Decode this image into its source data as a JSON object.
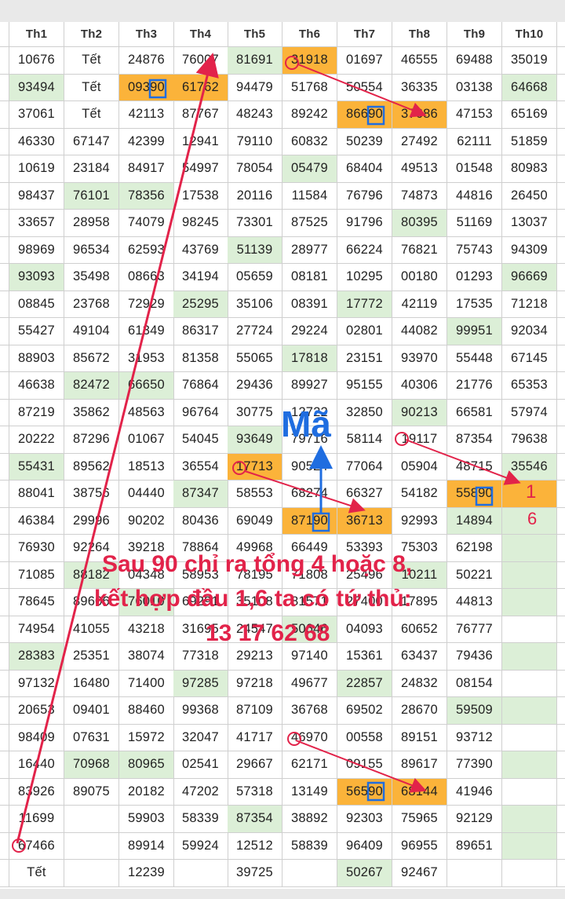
{
  "headers": [
    "Th1",
    "Th2",
    "Th3",
    "Th4",
    "Th5",
    "Th6",
    "Th7",
    "Th8",
    "Th9",
    "Th10"
  ],
  "rows": [
    [
      "10676",
      "Tết",
      "24876",
      "76007",
      "81691",
      "31918",
      "01697",
      "46555",
      "69488",
      "35019"
    ],
    [
      "93494",
      "Tết",
      "09390",
      "61762",
      "94479",
      "51768",
      "50554",
      "36335",
      "03138",
      "64668"
    ],
    [
      "37061",
      "Tết",
      "42113",
      "87767",
      "48243",
      "89242",
      "86690",
      "37686",
      "47153",
      "65169"
    ],
    [
      "46330",
      "67147",
      "42399",
      "12941",
      "79110",
      "60832",
      "50239",
      "27492",
      "62111",
      "51859"
    ],
    [
      "10619",
      "23184",
      "84917",
      "54997",
      "78054",
      "05479",
      "68404",
      "49513",
      "01548",
      "80983"
    ],
    [
      "98437",
      "76101",
      "78356",
      "17538",
      "20116",
      "11584",
      "76796",
      "74873",
      "44816",
      "26450"
    ],
    [
      "33657",
      "28958",
      "74079",
      "98245",
      "73301",
      "87525",
      "91796",
      "80395",
      "51169",
      "13037"
    ],
    [
      "98969",
      "96534",
      "62593",
      "43769",
      "51139",
      "28977",
      "66224",
      "76821",
      "75743",
      "94309"
    ],
    [
      "93093",
      "35498",
      "08663",
      "34194",
      "05659",
      "08181",
      "10295",
      "00180",
      "01293",
      "96669"
    ],
    [
      "08845",
      "23768",
      "72929",
      "25295",
      "35106",
      "08391",
      "17772",
      "42119",
      "17535",
      "71218"
    ],
    [
      "55427",
      "49104",
      "61349",
      "86317",
      "27724",
      "29224",
      "02801",
      "44082",
      "99951",
      "92034"
    ],
    [
      "88903",
      "85672",
      "31953",
      "81358",
      "55065",
      "17818",
      "23151",
      "93970",
      "55448",
      "67145"
    ],
    [
      "46638",
      "82472",
      "66650",
      "76864",
      "29436",
      "89927",
      "95155",
      "40306",
      "21776",
      "65353"
    ],
    [
      "87219",
      "35862",
      "48563",
      "96764",
      "30775",
      "12722",
      "32850",
      "90213",
      "66581",
      "57974"
    ],
    [
      "20222",
      "87296",
      "01067",
      "54045",
      "93649",
      "79716",
      "58114",
      "19117",
      "87354",
      "79638"
    ],
    [
      "55431",
      "89562",
      "18513",
      "36554",
      "17713",
      "90524",
      "77064",
      "05904",
      "48715",
      "35546"
    ],
    [
      "88041",
      "38756",
      "04440",
      "87347",
      "58553",
      "68274",
      "66327",
      "54182",
      "55890",
      ""
    ],
    [
      "46384",
      "29996",
      "90202",
      "80436",
      "69049",
      "87190",
      "36713",
      "92993",
      "14894",
      ""
    ],
    [
      "76930",
      "92264",
      "39218",
      "78864",
      "49968",
      "66449",
      "53393",
      "75303",
      "62198",
      ""
    ],
    [
      "71085",
      "88182",
      "04348",
      "58953",
      "78195",
      "71808",
      "25496",
      "10211",
      "50221",
      ""
    ],
    [
      "78645",
      "89606",
      "76010",
      "69291",
      "35108",
      "81571",
      "27400",
      "17895",
      "44813",
      ""
    ],
    [
      "74954",
      "41055",
      "43218",
      "31695",
      "24547",
      "50646",
      "04093",
      "60652",
      "76777",
      ""
    ],
    [
      "28383",
      "25351",
      "38074",
      "77318",
      "29213",
      "97140",
      "15361",
      "63437",
      "79436",
      ""
    ],
    [
      "97132",
      "16480",
      "71400",
      "97285",
      "97218",
      "49677",
      "22857",
      "24832",
      "08154",
      ""
    ],
    [
      "20653",
      "09401",
      "88460",
      "99368",
      "87109",
      "36768",
      "69502",
      "28670",
      "59509",
      ""
    ],
    [
      "98409",
      "07631",
      "15972",
      "32047",
      "41717",
      "46970",
      "00558",
      "89151",
      "93712",
      ""
    ],
    [
      "16440",
      "70968",
      "80965",
      "02541",
      "29667",
      "62171",
      "09155",
      "89617",
      "77390",
      ""
    ],
    [
      "83926",
      "89075",
      "20182",
      "47202",
      "57318",
      "13149",
      "56590",
      "68144",
      "41946",
      ""
    ],
    [
      "11699",
      "",
      "59903",
      "58339",
      "87354",
      "38892",
      "92303",
      "75965",
      "92129",
      ""
    ],
    [
      "67466",
      "",
      "89914",
      "59924",
      "12512",
      "58839",
      "96409",
      "96955",
      "89651",
      ""
    ],
    [
      "Tết",
      "",
      "12239",
      "",
      "39725",
      "",
      "50267",
      "92467",
      "",
      ""
    ]
  ],
  "green_cells": [
    [
      1,
      0
    ],
    [
      0,
      4
    ],
    [
      1,
      9
    ],
    [
      5,
      1
    ],
    [
      5,
      2
    ],
    [
      4,
      5
    ],
    [
      6,
      7
    ],
    [
      7,
      4
    ],
    [
      8,
      0
    ],
    [
      8,
      9
    ],
    [
      9,
      3
    ],
    [
      9,
      6
    ],
    [
      10,
      8
    ],
    [
      11,
      5
    ],
    [
      12,
      1
    ],
    [
      12,
      2
    ],
    [
      13,
      7
    ],
    [
      14,
      4
    ],
    [
      15,
      0
    ],
    [
      15,
      9
    ],
    [
      16,
      3
    ],
    [
      17,
      8
    ],
    [
      19,
      1
    ],
    [
      19,
      7
    ],
    [
      20,
      2
    ],
    [
      21,
      5
    ],
    [
      22,
      0
    ],
    [
      23,
      3
    ],
    [
      23,
      6
    ],
    [
      24,
      8
    ],
    [
      26,
      1
    ],
    [
      26,
      2
    ],
    [
      28,
      4
    ],
    [
      30,
      6
    ],
    [
      16,
      9
    ],
    [
      17,
      9
    ],
    [
      18,
      9
    ],
    [
      19,
      9
    ],
    [
      20,
      9
    ],
    [
      22,
      9
    ],
    [
      24,
      9
    ],
    [
      26,
      9
    ],
    [
      28,
      9
    ],
    [
      29,
      9
    ]
  ],
  "orange_cells": [
    [
      0,
      5
    ],
    [
      1,
      2
    ],
    [
      1,
      3
    ],
    [
      2,
      6
    ],
    [
      2,
      7
    ],
    [
      15,
      4
    ],
    [
      16,
      8
    ],
    [
      16,
      9
    ],
    [
      17,
      5
    ],
    [
      17,
      6
    ],
    [
      27,
      6
    ],
    [
      27,
      7
    ]
  ],
  "annotation": {
    "ma_label": "Mã",
    "caption_line1": "Sau 90 chỉ ra tổng 4 hoặc 8,",
    "caption_line2": "kết hợp đầu 1,6 ta có tứ thủ:",
    "caption_line3": "13 17 62 68",
    "margin_note_top": "1",
    "margin_note_bottom": "6"
  },
  "colors": {
    "green": "#dcefd7",
    "orange": "#fbb33a",
    "annotation_red": "#e2234a",
    "annotation_blue": "#1f6de0"
  }
}
